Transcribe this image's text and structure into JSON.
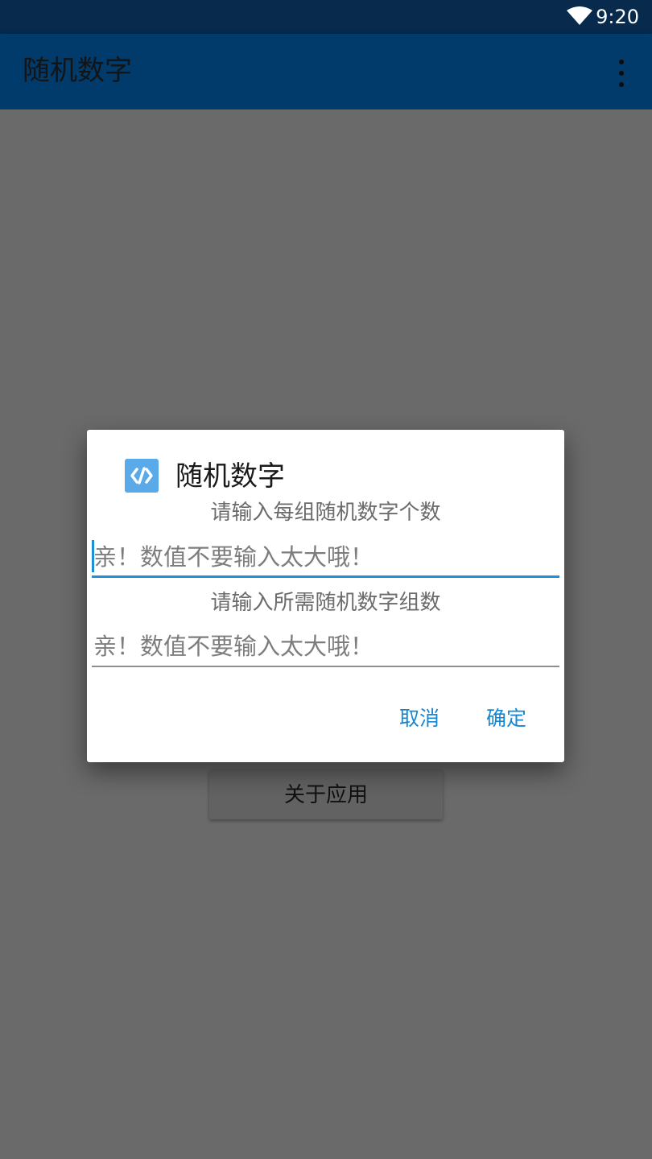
{
  "status_bar": {
    "time": "9:20",
    "icons": [
      "wifi-icon"
    ]
  },
  "app_bar": {
    "title": "随机数字",
    "menu_icon": "more-vert-icon"
  },
  "main": {
    "about_button_label": "关于应用"
  },
  "dialog": {
    "icon": "code-icon",
    "title": "随机数字",
    "prompt_1": "请输入每组随机数字个数",
    "input_1": {
      "value": "",
      "placeholder": "亲！数值不要输入太大哦！"
    },
    "prompt_2": "请输入所需随机数字组数",
    "input_2": {
      "value": "",
      "placeholder": "亲！数值不要输入太大哦！"
    },
    "cancel_label": "取消",
    "confirm_label": "确定"
  },
  "colors": {
    "status_bar": "#072a4d",
    "app_bar": "#003b6b",
    "accent": "#1887d3",
    "scrim": "#6a6a6a"
  }
}
